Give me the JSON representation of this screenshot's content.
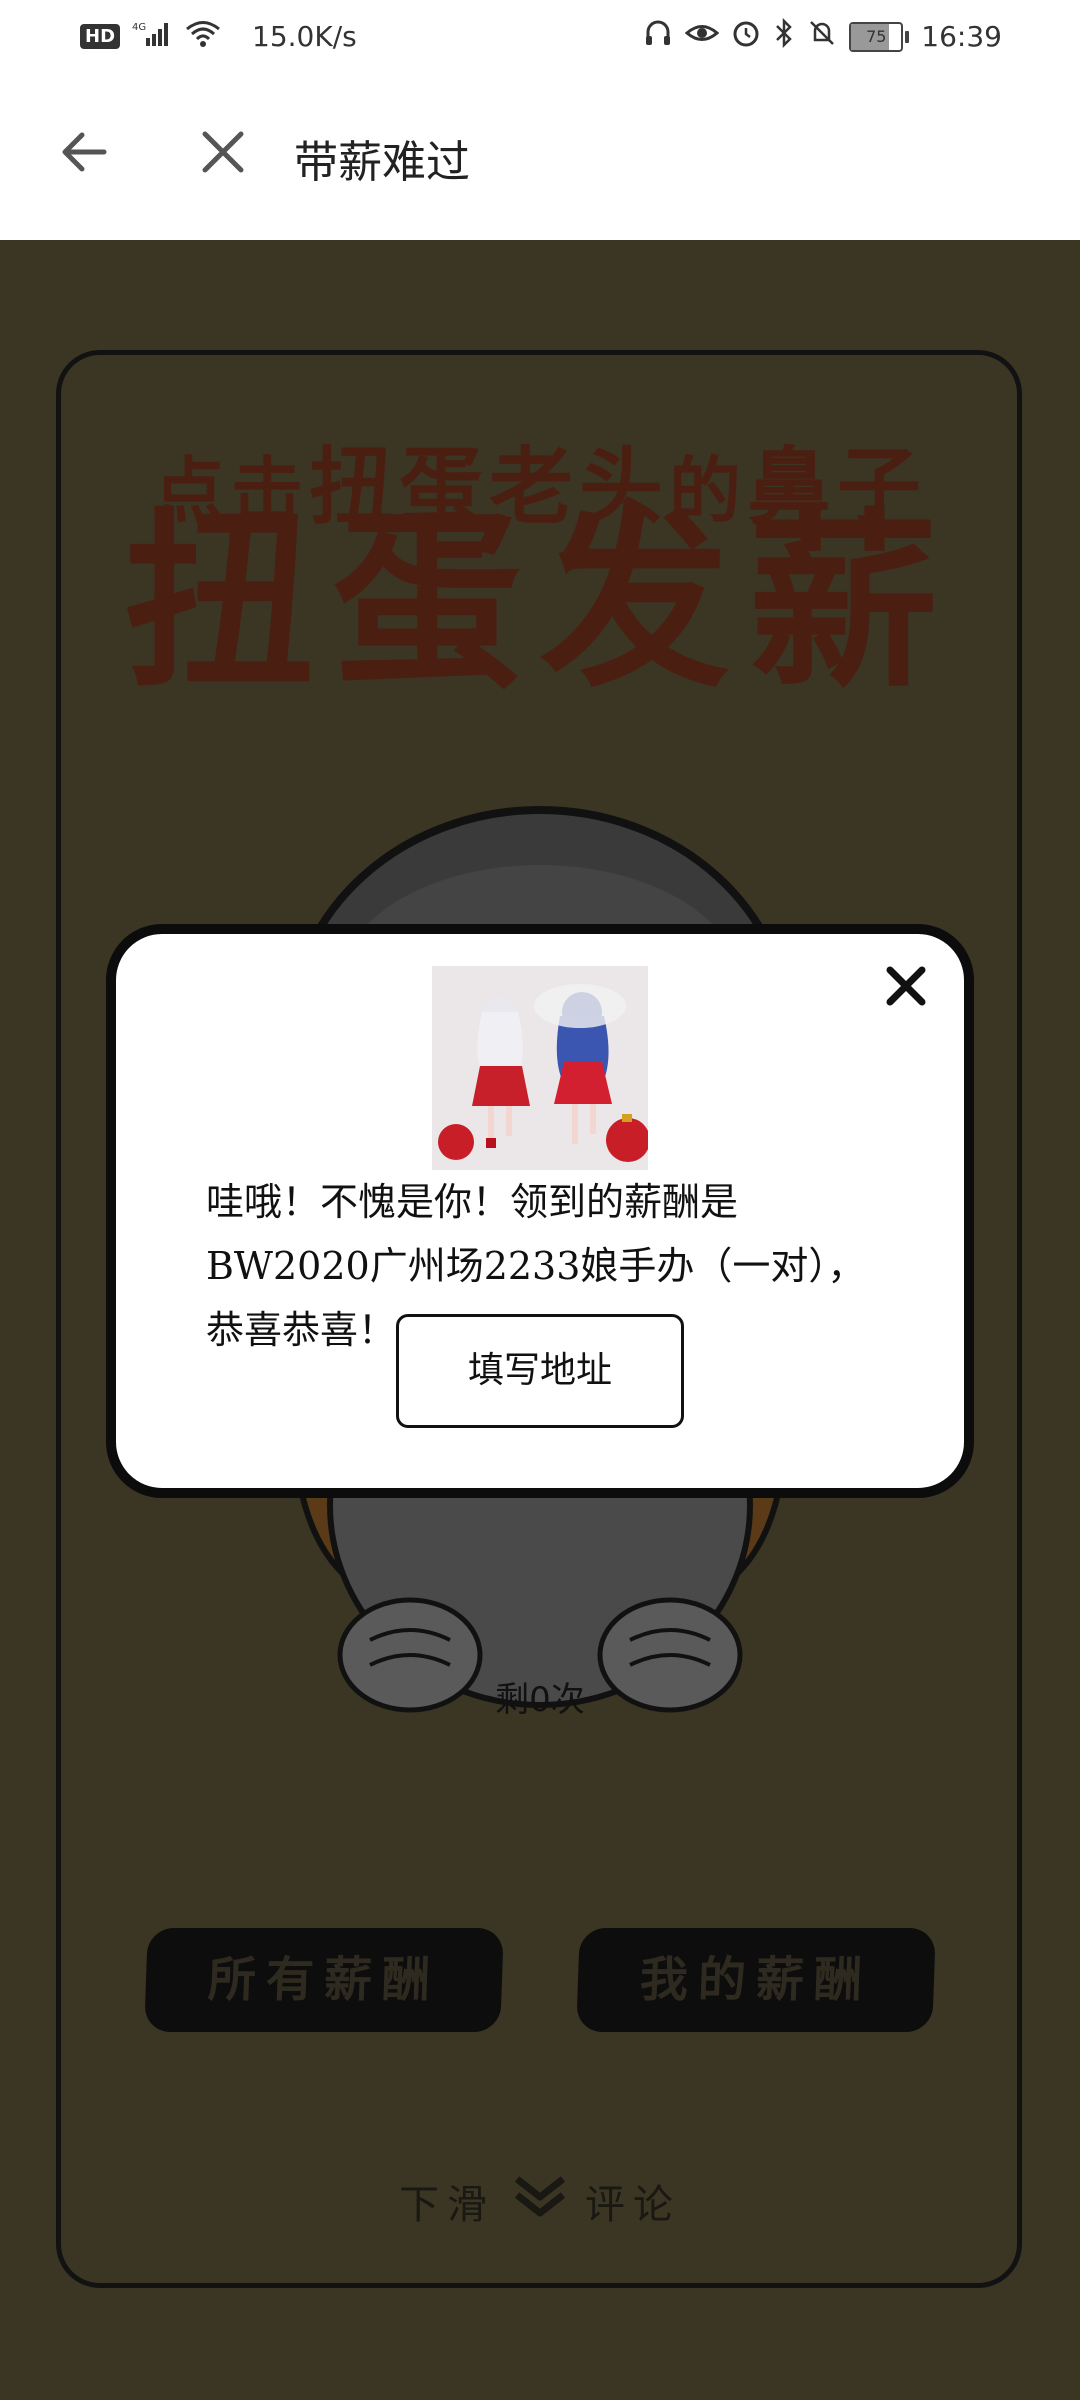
{
  "status_bar": {
    "hd": "HD",
    "network": "4G",
    "speed": "15.0K/s",
    "battery": "75",
    "time": "16:39",
    "battery_level": 0.75,
    "icons": [
      "headphones-icon",
      "eye-icon",
      "alarm-icon",
      "bluetooth-icon",
      "mute-bell-icon"
    ]
  },
  "header": {
    "title": "带薪难过"
  },
  "game": {
    "subtitle_prefix": "点击",
    "subtitle_big": "扭蛋老头",
    "subtitle_mid": "的",
    "subtitle_end": "鼻子",
    "main_title": "扭蛋发薪",
    "remaining": "剩0次",
    "all_rewards": "所有薪酬",
    "my_rewards": "我的薪酬",
    "scroll_left": "下滑",
    "scroll_right": "评论"
  },
  "modal": {
    "message": "哇哦！不愧是你！领到的薪酬是BW2020广州场2233娘手办（一对），恭喜恭喜！",
    "address_button": "填写地址"
  },
  "colors": {
    "overlay_bg": "#3b3624",
    "heading": "#4a1f12",
    "modal_border": "#0c0c0c"
  }
}
